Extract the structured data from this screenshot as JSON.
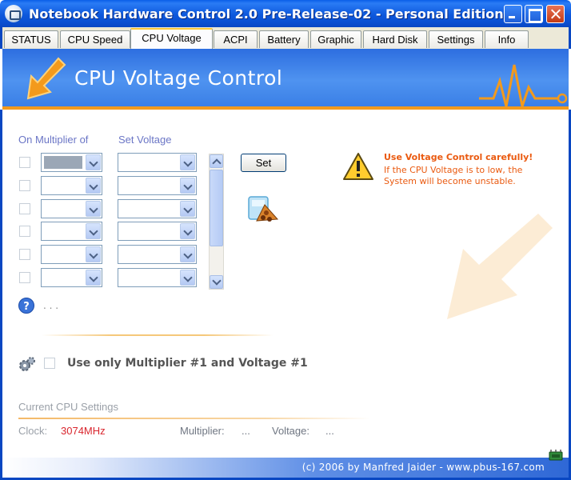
{
  "window": {
    "title": "Notebook Hardware Control 2.0 Pre-Release-02  -  Personal Edition"
  },
  "tabs": [
    {
      "label": "STATUS"
    },
    {
      "label": "CPU Speed"
    },
    {
      "label": "CPU Voltage",
      "active": true
    },
    {
      "label": "ACPI"
    },
    {
      "label": "Battery"
    },
    {
      "label": "Graphic"
    },
    {
      "label": "Hard Disk"
    },
    {
      "label": "Settings"
    },
    {
      "label": "Info"
    }
  ],
  "banner": {
    "title": "CPU Voltage Control"
  },
  "voltage_table": {
    "multiplier_header": "On Multiplier of",
    "voltage_header": "Set Voltage",
    "row_count": 6
  },
  "set_button": "Set",
  "warning": {
    "title": "Use Voltage Control carefully!",
    "text": "If the CPU Voltage is to low, the System will become unstable."
  },
  "help_dots": ". . .",
  "option": {
    "label": "Use only Multiplier #1 and Voltage #1",
    "checked": false
  },
  "current": {
    "section_label": "Current CPU Settings",
    "clock_label": "Clock:",
    "clock_value": "3074MHz",
    "multiplier_label": "Multiplier:",
    "multiplier_value": "...",
    "voltage_label": "Voltage:",
    "voltage_value": "..."
  },
  "footer": {
    "text": "(c) 2006 by Manfred Jaider  -  www.pbus-167.com"
  },
  "colors": {
    "accent_orange": "#f39a1c",
    "warning": "#ea5a10",
    "clock_value": "#d9262e",
    "label_blue": "#6b76c6"
  },
  "icons": {
    "app": "notebook-icon",
    "banner": "arrow-icon",
    "warning": "warning-triangle-icon",
    "help": "help-icon",
    "gear": "gear-icon",
    "tray": "chip-icon"
  }
}
